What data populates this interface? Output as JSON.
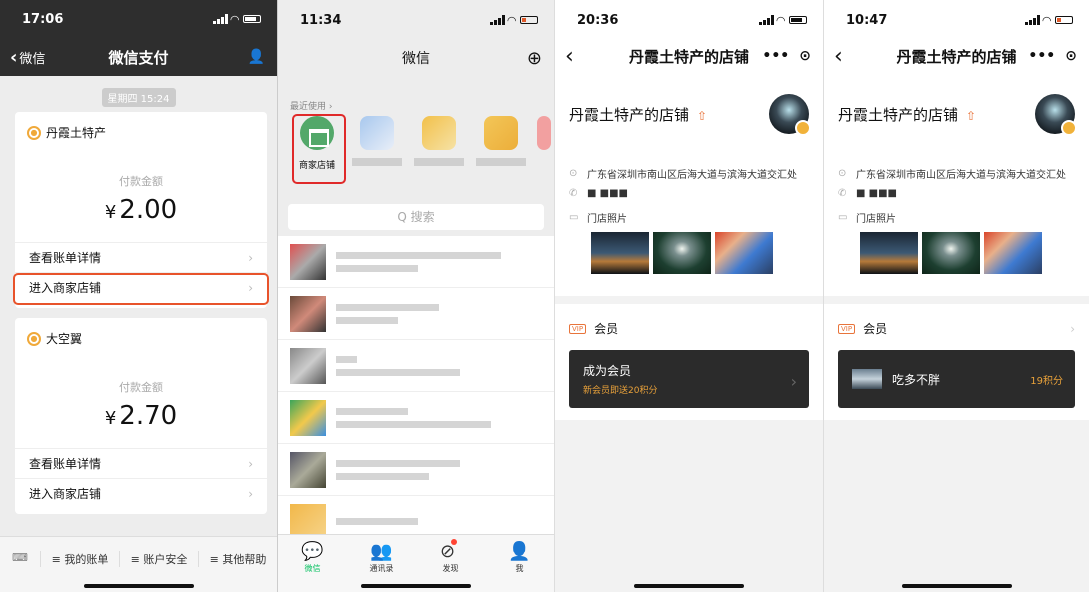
{
  "panel1": {
    "status_time": "17:06",
    "back": "微信",
    "title": "微信支付",
    "time_chip": "星期四 15:24",
    "cards": [
      {
        "merchant": "丹霞土特产",
        "amount_label": "付款金额",
        "currency": "¥",
        "amount": "2.00",
        "row1": "查看账单详情",
        "row2": "进入商家店铺"
      },
      {
        "merchant": "大空翼",
        "amount_label": "付款金额",
        "currency": "¥",
        "amount": "2.70",
        "row1": "查看账单详情",
        "row2": "进入商家店铺"
      }
    ],
    "bottom": {
      "keyboard": "⌨",
      "bill": "≡ 我的账单",
      "security": "≡ 账户安全",
      "help": "≡ 其他帮助"
    },
    "highlight_color": "#e8532b"
  },
  "panel2": {
    "status_time": "11:34",
    "title": "微信",
    "recent_label": "最近使用 ›",
    "shop_label": "商家店铺",
    "search_placeholder": "Q 搜索",
    "tabs": [
      {
        "label": "微信",
        "icon": "💬"
      },
      {
        "label": "通讯录",
        "icon": "👥"
      },
      {
        "label": "发现",
        "icon": "⊘"
      },
      {
        "label": "我",
        "icon": "👤"
      }
    ],
    "accent": "#07c160"
  },
  "panel3": {
    "status_time": "20:36",
    "title": "丹霞土特产的店铺",
    "shop_name": "丹霞土特产的店铺",
    "share_icon": "⇧",
    "address": "广东省深圳市南山区后海大道与滨海大道交汇处",
    "phone_masked": "■ ■■■",
    "photos_label": "门店照片",
    "member_label": "会员",
    "vip_badge": "VIP",
    "card_title": "成为会员",
    "card_sub": "新会员即送20积分"
  },
  "panel4": {
    "status_time": "10:47",
    "title": "丹霞土特产的店铺",
    "shop_name": "丹霞土特产的店铺",
    "share_icon": "⇧",
    "address": "广东省深圳市南山区后海大道与滨海大道交汇处",
    "phone_masked": "■ ■■■",
    "photos_label": "门店照片",
    "member_label": "会员",
    "vip_badge": "VIP",
    "card_title": "吃多不胖",
    "card_points": "19积分"
  }
}
